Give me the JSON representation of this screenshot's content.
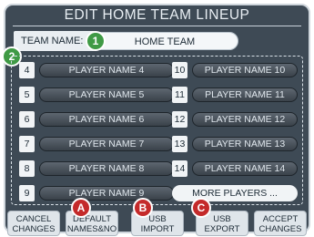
{
  "title": "EDIT HOME TEAM LINEUP",
  "team": {
    "label": "TEAM NAME:",
    "value": "HOME TEAM"
  },
  "callouts": {
    "one": "1",
    "two": "2",
    "a": "A",
    "b": "B",
    "c": "C"
  },
  "players_left": [
    {
      "num": "4",
      "name": "PLAYER NAME 4"
    },
    {
      "num": "5",
      "name": "PLAYER NAME 5"
    },
    {
      "num": "6",
      "name": "PLAYER NAME 6"
    },
    {
      "num": "7",
      "name": "PLAYER NAME 7"
    },
    {
      "num": "8",
      "name": "PLAYER NAME 8"
    },
    {
      "num": "9",
      "name": "PLAYER NAME 9"
    }
  ],
  "players_right": [
    {
      "num": "10",
      "name": "PLAYER NAME 10"
    },
    {
      "num": "11",
      "name": "PLAYER NAME 11"
    },
    {
      "num": "12",
      "name": "PLAYER NAME 12"
    },
    {
      "num": "13",
      "name": "PLAYER NAME 13"
    },
    {
      "num": "14",
      "name": "PLAYER NAME 14"
    }
  ],
  "more_label": "MORE PLAYERS ...",
  "buttons": [
    {
      "line1": "CANCEL",
      "line2": "CHANGES"
    },
    {
      "line1": "DEFAULT",
      "line2": "NAMES&NO"
    },
    {
      "line1": "USB",
      "line2": "IMPORT"
    },
    {
      "line1": "USB",
      "line2": "EXPORT"
    },
    {
      "line1": "ACCEPT",
      "line2": "CHANGES"
    }
  ],
  "colors": {
    "panel": "#3e4a55",
    "green_callout": "#3f9a45",
    "red_callout": "#c42a2a"
  }
}
